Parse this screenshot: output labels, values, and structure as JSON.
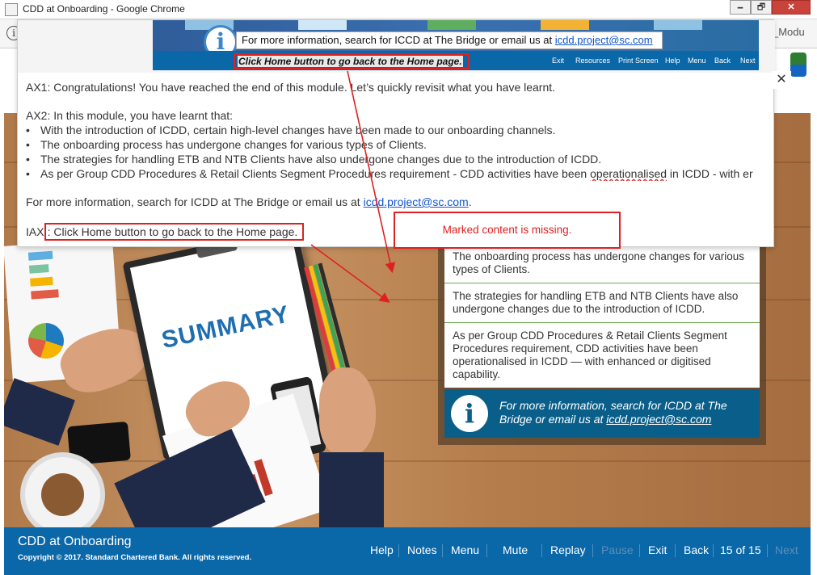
{
  "window": {
    "title": "CDD at Onboarding - Google Chrome",
    "min_label": "🗕",
    "max_label": "🗗",
    "close_label": "✕",
    "address_tail": "_Modu"
  },
  "popup": {
    "info_text": "For more information, search for ICCD at The Bridge or email us at ",
    "info_email": "icdd.project@sc.com",
    "highlighted_instruction": "Click Home button to go back to the Home page.",
    "top_nav": [
      "Exit",
      "Resources",
      "Print Screen",
      "Help",
      "Menu",
      "Back",
      "Next"
    ],
    "close_label": "✕",
    "ax1": "AX1: Congratulations! You have reached the end of this module. Let’s quickly revisit what you have learnt.",
    "ax2_heading": "AX2: In this module, you have learnt that:",
    "ax2_bullets": [
      "With the introduction of ICDD, certain high-level changes have been made to our onboarding channels.",
      "The onboarding process has undergone changes for various types of Clients.",
      "The strategies for handling ETB and NTB Clients have also undergone changes due to the introduction of ICDD."
    ],
    "ax2_bullet4_prefix": "As per Group CDD Procedures & Retail Clients Segment Procedures requirement - CDD activities have been ",
    "ax2_bullet4_marked": "operationalised",
    "ax2_bullet4_suffix": " in ICDD - with er",
    "more_info_prefix": "For more information, search for ICDD at The Bridge or email us at ",
    "more_info_email": "icdd.project@sc.com",
    "more_info_suffix": ".",
    "iax_prefix": "IAX",
    "iax_text": ": Click Home button to go back to the Home page.",
    "missing_note": "Marked content is missing."
  },
  "slide": {
    "summary_word": "SUMMARY",
    "panel_items": [
      "The onboarding process has undergone changes for various types of Clients.",
      "The strategies for handling ETB and NTB Clients have also undergone changes due to the introduction of ICDD.",
      "As per Group CDD Procedures & Retail Clients Segment Procedures requirement, CDD activities have been operationalised in ICDD — with enhanced or digitised capability."
    ],
    "panel_info_prefix": "For more information, search for ICDD at The Bridge or email us at ",
    "panel_info_email": "icdd.project@sc.com",
    "panel_icon": "i"
  },
  "navbar": {
    "course_title": "CDD at Onboarding",
    "copyright": "Copyright © 2017. Standard Chartered Bank. All rights reserved.",
    "help": "Help",
    "notes": "Notes",
    "menu": "Menu",
    "mute": "Mute",
    "replay": "Replay",
    "pause": "Pause",
    "exit": "Exit",
    "back": "Back",
    "page_indicator": "15 of 15",
    "next": "Next"
  },
  "colors": {
    "annotation_red": "#e02020",
    "nav_blue": "#0a67a8",
    "panel_blue": "#0a5f8a",
    "link_blue": "#1155cc"
  }
}
